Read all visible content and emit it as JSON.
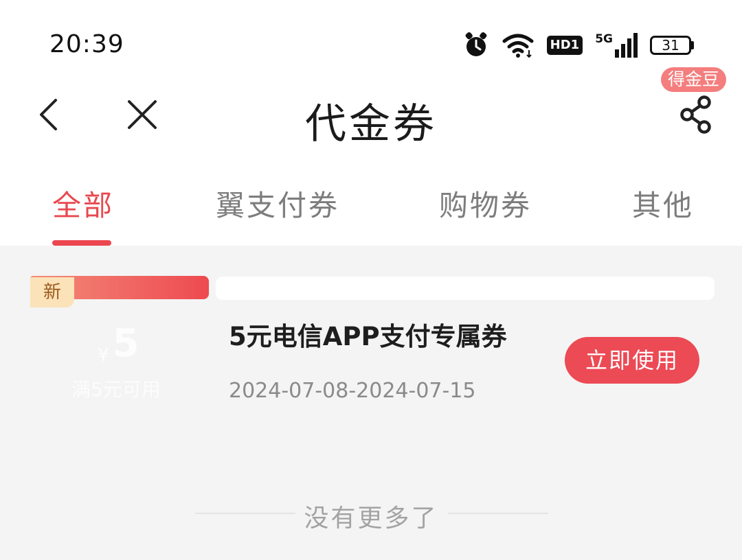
{
  "status_bar": {
    "time": "20:39",
    "icons": [
      "alarm-icon",
      "wifi-icon",
      "hd-icon",
      "signal-5g-icon",
      "battery-icon"
    ],
    "hd_label": "HD1",
    "network_label": "5G",
    "battery_level": "31"
  },
  "nav": {
    "back_icon": "chevron-left-icon",
    "close_icon": "close-icon",
    "title": "代金券",
    "badge": "得金豆",
    "share_icon": "share-icon"
  },
  "tabs": [
    {
      "label": "全部",
      "active": true
    },
    {
      "label": "翼支付券",
      "active": false
    },
    {
      "label": "购物券",
      "active": false
    },
    {
      "label": "其他",
      "active": false
    }
  ],
  "coupon": {
    "tag": "新",
    "currency": "¥",
    "amount": "5",
    "condition": "满5元可用",
    "name": "5元电信APP支付专属券",
    "validity": "2024-07-08-2024-07-15",
    "action": "立即使用"
  },
  "footer": {
    "end_text": "没有更多了"
  },
  "colors": {
    "accent": "#ec4650",
    "badge": "#f47d7d",
    "tag_bg": "#fbe2b8",
    "page_bg": "#f4f4f4"
  }
}
